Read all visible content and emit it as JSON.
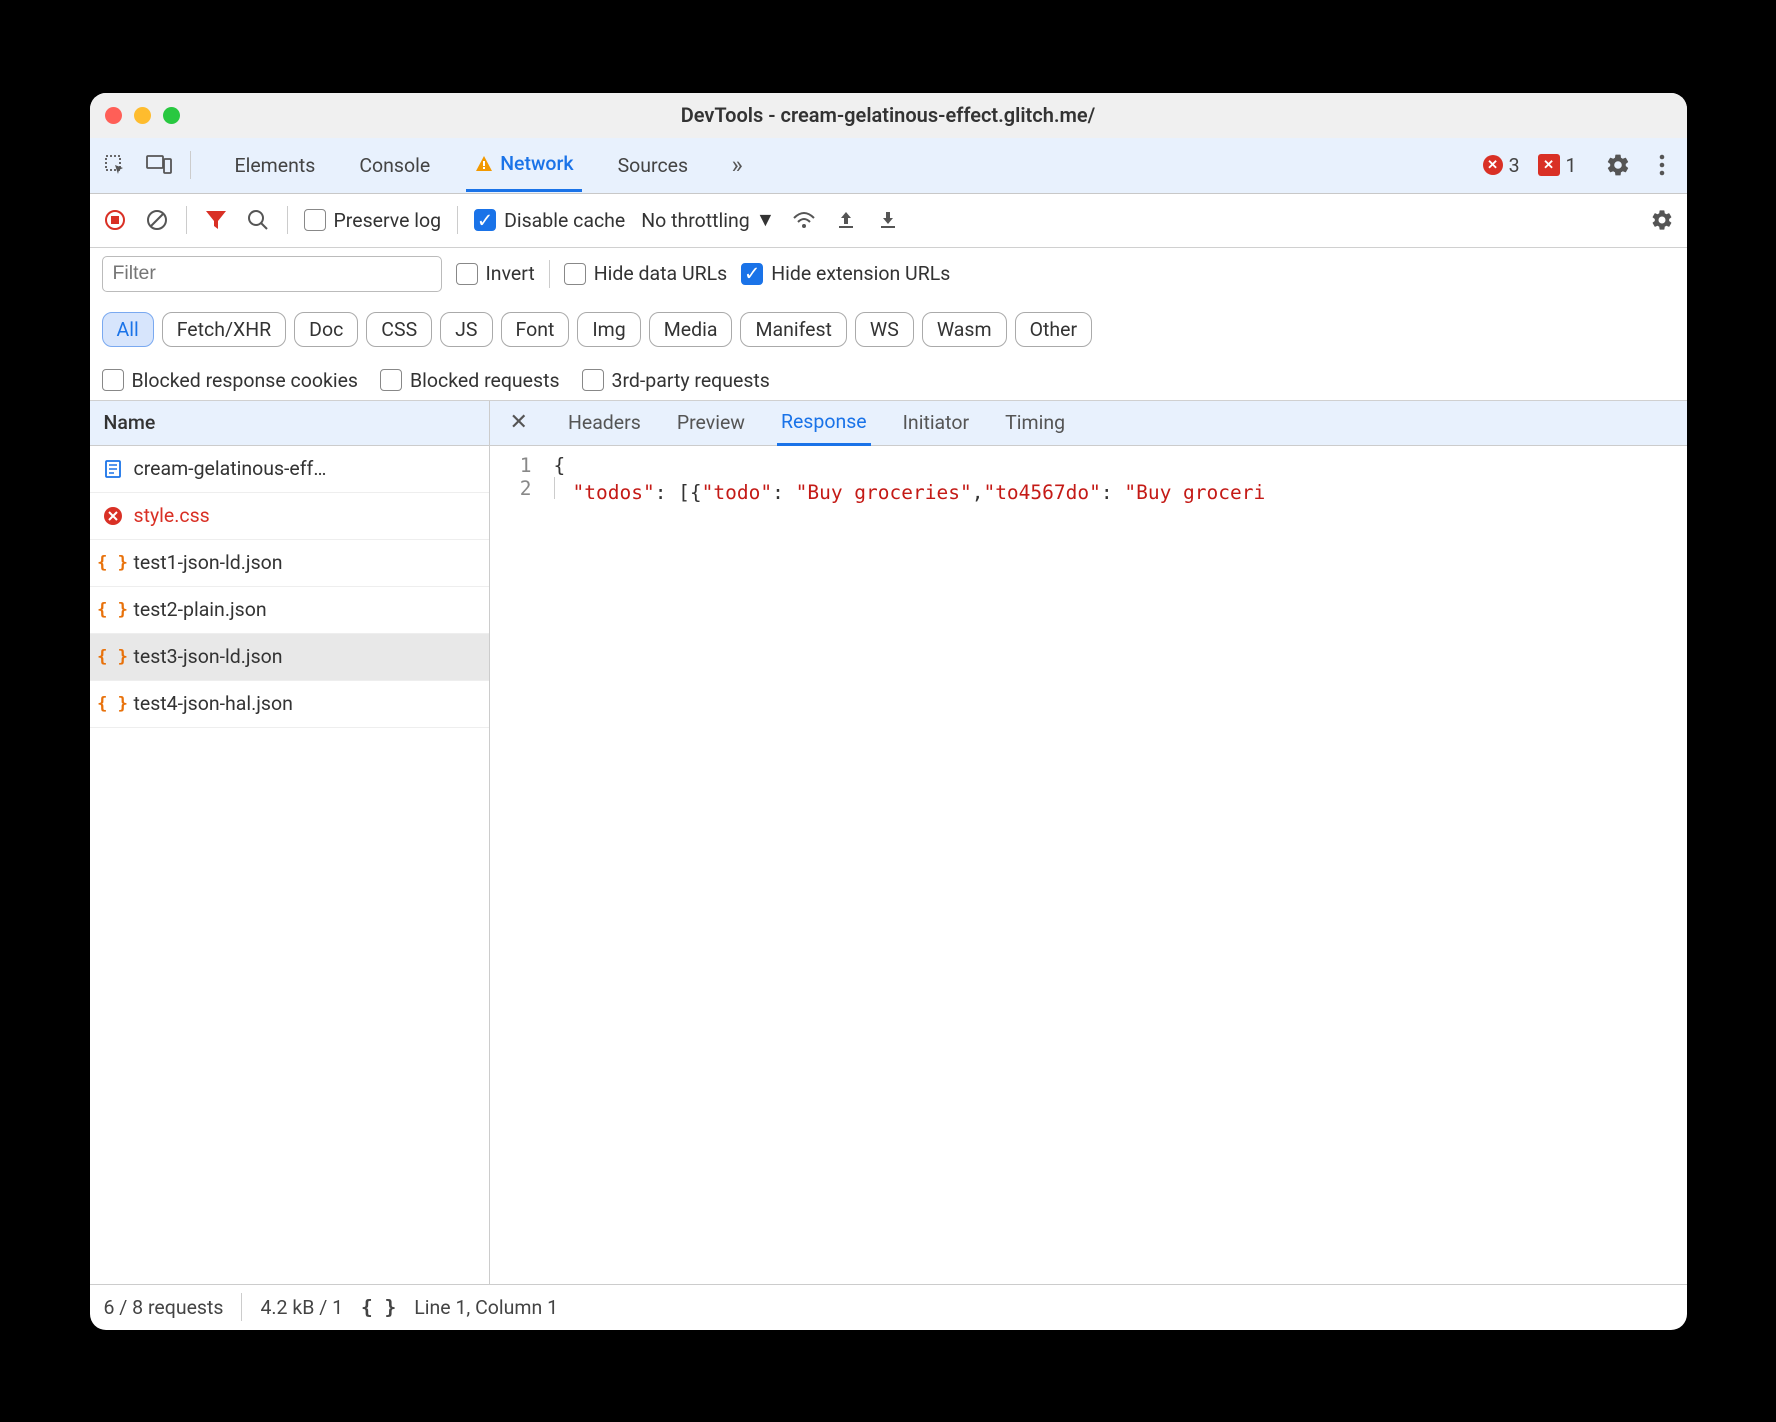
{
  "window": {
    "title": "DevTools - cream-gelatinous-effect.glitch.me/"
  },
  "topTabs": {
    "items": [
      "Elements",
      "Console",
      "Network",
      "Sources"
    ],
    "activeIndex": 2,
    "activeHasWarning": true
  },
  "errors": {
    "redCount": "3",
    "sqCount": "1"
  },
  "networkToolbar": {
    "preserveLog": "Preserve log",
    "disableCache": "Disable cache",
    "throttling": "No throttling"
  },
  "filterBar": {
    "placeholder": "Filter",
    "invert": "Invert",
    "hideDataUrls": "Hide data URLs",
    "hideExtUrls": "Hide extension URLs",
    "chips": [
      "All",
      "Fetch/XHR",
      "Doc",
      "CSS",
      "JS",
      "Font",
      "Img",
      "Media",
      "Manifest",
      "WS",
      "Wasm",
      "Other"
    ],
    "activeChip": 0,
    "blockedCookies": "Blocked response cookies",
    "blockedRequests": "Blocked requests",
    "thirdParty": "3rd-party requests"
  },
  "sidebar": {
    "header": "Name",
    "items": [
      {
        "name": "cream-gelatinous-eff…",
        "type": "doc",
        "error": false
      },
      {
        "name": "style.css",
        "type": "error",
        "error": true
      },
      {
        "name": "test1-json-ld.json",
        "type": "json",
        "error": false
      },
      {
        "name": "test2-plain.json",
        "type": "json",
        "error": false
      },
      {
        "name": "test3-json-ld.json",
        "type": "json",
        "error": false,
        "selected": true
      },
      {
        "name": "test4-json-hal.json",
        "type": "json",
        "error": false
      }
    ]
  },
  "detailTabs": {
    "items": [
      "Headers",
      "Preview",
      "Response",
      "Initiator",
      "Timing"
    ],
    "activeIndex": 2
  },
  "responseBody": {
    "line1_no": "1",
    "line1_txt": "{",
    "line2_no": "2",
    "line2_k1": "\"todos\"",
    "line2_p1": ": [{",
    "line2_k2": "\"todo\"",
    "line2_p2": ": ",
    "line2_k3": "\"Buy groceries\"",
    "line2_p3": ",",
    "line2_k4": "\"to4567do\"",
    "line2_p4": ": ",
    "line2_k5": "\"Buy groceri"
  },
  "status": {
    "requests": "6 / 8 requests",
    "size": "4.2 kB / 1",
    "cursor": "Line 1, Column 1"
  }
}
